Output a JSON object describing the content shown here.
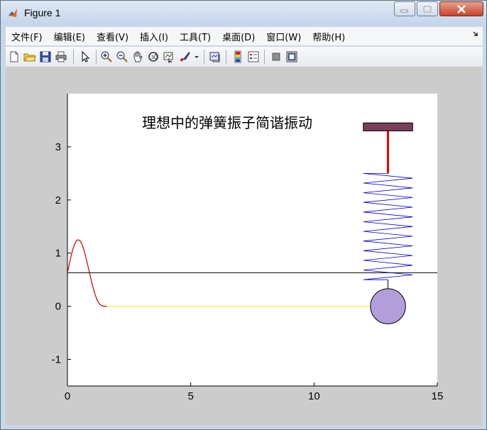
{
  "window": {
    "title": "Figure 1"
  },
  "menu": {
    "items": [
      "文件(F)",
      "编辑(E)",
      "查看(V)",
      "插入(I)",
      "工具(T)",
      "桌面(D)",
      "窗口(W)",
      "帮助(H)"
    ]
  },
  "toolbar": {
    "icons": [
      "new-figure-icon",
      "open-file-icon",
      "save-icon",
      "print-icon",
      "select-arrow-icon",
      "zoom-in-icon",
      "zoom-out-icon",
      "pan-hand-icon",
      "rotate-3d-icon",
      "data-cursor-icon",
      "brush-icon",
      "brush-dropdown-icon",
      "link-plot-icon",
      "colorbar-icon",
      "legend-icon",
      "hide-plot-tools-icon",
      "show-plot-tools-icon"
    ]
  },
  "colors": {
    "wave": "#cc0000",
    "tether": "#ffff00",
    "spring": "#0000cc",
    "support_plate": "#7a3f5a",
    "support_rod": "#ee0000",
    "mass": "#b39ddb",
    "axis_line": "#000000"
  },
  "chart_data": {
    "type": "line",
    "title": "理想中的弹簧振子简谐振动",
    "xlim": [
      0,
      15
    ],
    "ylim": [
      -1.5,
      4.0
    ],
    "xticks": [
      0,
      5,
      10,
      15
    ],
    "yticks": [
      -1,
      0,
      1,
      2,
      3
    ],
    "xtick_labels": [
      "0",
      "5",
      "10",
      "15"
    ],
    "ytick_labels": [
      "-1",
      "0",
      "1",
      "2",
      "3"
    ],
    "grid": false,
    "series": [
      {
        "kind": "wave",
        "x": [
          0,
          0.1,
          0.2,
          0.3,
          0.4,
          0.5,
          0.6,
          0.7,
          0.8,
          0.9,
          1.0,
          1.1,
          1.2,
          1.3,
          1.4,
          1.5,
          1.6
        ],
        "y": [
          0.63,
          0.85,
          1.04,
          1.18,
          1.25,
          1.24,
          1.16,
          1.01,
          0.82,
          0.62,
          0.42,
          0.25,
          0.12,
          0.04,
          0.01,
          0.0,
          0.0
        ]
      },
      {
        "kind": "tether",
        "x": [
          1.6,
          13.0
        ],
        "y": [
          0.0,
          0.0
        ]
      },
      {
        "kind": "equilibrium-line",
        "x": [
          0,
          15
        ],
        "y": [
          0.63,
          0.63
        ]
      },
      {
        "kind": "spring",
        "x_center": 13.0,
        "x_half_width": 1.0,
        "y_top": 2.5,
        "y_bottom": 0.5,
        "coils": 22
      },
      {
        "kind": "spring-hook",
        "x": [
          13.0,
          13.0
        ],
        "y": [
          0.5,
          0.15
        ]
      },
      {
        "kind": "support-rod",
        "x": [
          13.0,
          13.0
        ],
        "y": [
          3.3,
          2.5
        ]
      },
      {
        "kind": "support-plate",
        "x": [
          12.0,
          14.0
        ],
        "y": [
          3.3,
          3.45
        ]
      },
      {
        "kind": "mass",
        "x": 13.0,
        "y": 0.0,
        "radius": 0.33
      }
    ]
  }
}
